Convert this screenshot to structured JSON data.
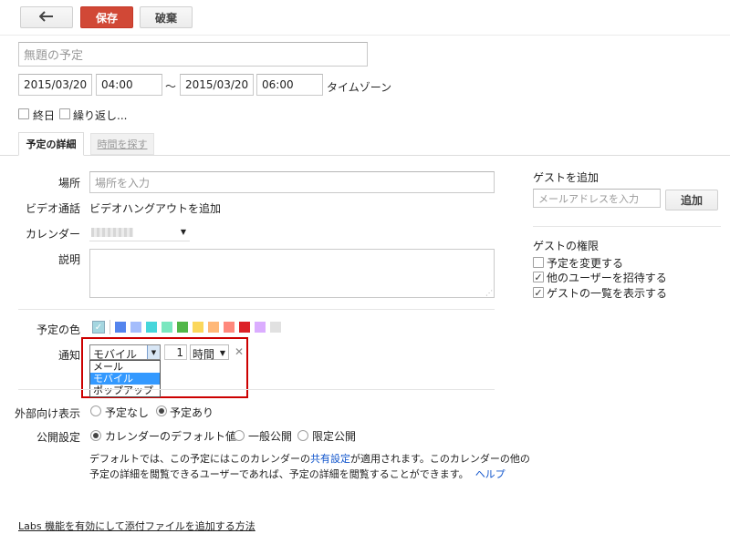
{
  "toolbar": {
    "back_icon": "back-arrow-icon",
    "save_label": "保存",
    "discard_label": "破棄"
  },
  "title_field": {
    "placeholder": "無題の予定"
  },
  "datetime": {
    "start_date": "2015/03/20",
    "start_time": "04:00",
    "separator": "～",
    "end_date": "2015/03/20",
    "end_time": "06:00",
    "timezone_label": "タイムゾーン"
  },
  "options": {
    "allday_label": "終日",
    "repeat_label": "繰り返し..."
  },
  "tabs": {
    "details": "予定の詳細",
    "find_time": "時間を探す"
  },
  "form": {
    "location_label": "場所",
    "location_placeholder": "場所を入力",
    "video_label": "ビデオ通話",
    "video_link": "ビデオハングアウトを追加",
    "calendar_label": "カレンダー",
    "description_label": "説明",
    "color_label": "予定の色",
    "notify_label": "通知",
    "notify_method": "モバイル",
    "notify_amount": "1",
    "notify_unit": "時間",
    "notify_options": [
      "メール",
      "モバイル",
      "ポップアップ"
    ],
    "notify_selected": "モバイル",
    "visibility_label": "外部向け表示",
    "visibility_options": [
      "予定なし",
      "予定あり"
    ],
    "visibility_selected": "予定あり",
    "privacy_label": "公開設定",
    "privacy_options": [
      "カレンダーのデフォルト値",
      "一般公開",
      "限定公開"
    ],
    "privacy_selected": "カレンダーのデフォルト値",
    "privacy_text_1": "デフォルトでは、この予定にはこのカレンダーの",
    "privacy_text_link": "共有設定",
    "privacy_text_2": "が適用されます。このカレンダーの他の",
    "privacy_text_3": "予定の詳細を閲覧できるユーザーであれば、予定の詳細を閲覧することができます。",
    "help_link": "ヘルプ"
  },
  "colors": {
    "default_swatch": "#a4d6e0",
    "palette": [
      "#5484ed",
      "#a4bdfc",
      "#46d6db",
      "#7ae7bf",
      "#51b749",
      "#fbd75b",
      "#ffb878",
      "#ff887c",
      "#dc2127",
      "#dbadff",
      "#e1e1e1"
    ],
    "highlight_border": "#cc0000"
  },
  "guests": {
    "heading": "ゲストを追加",
    "email_placeholder": "メールアドレスを入力",
    "add_label": "追加",
    "perms_heading": "ゲストの権限",
    "perms": [
      {
        "label": "予定を変更する",
        "checked": false
      },
      {
        "label": "他のユーザーを招待する",
        "checked": true
      },
      {
        "label": "ゲストの一覧を表示する",
        "checked": true
      }
    ]
  },
  "footer": {
    "labs_link": "Labs 機能を有効にして添付ファイルを追加する方法"
  }
}
